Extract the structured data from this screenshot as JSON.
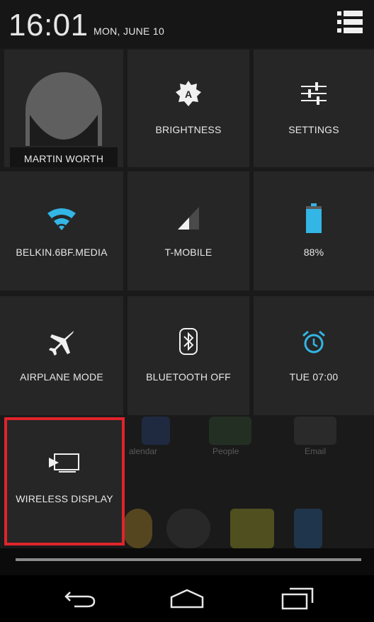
{
  "status_bar": {
    "time": "16:01",
    "date": "MON, JUNE 10"
  },
  "quick_settings": {
    "profile": {
      "name": "MARTIN WORTH"
    },
    "brightness": {
      "label": "BRIGHTNESS"
    },
    "settings": {
      "label": "SETTINGS"
    },
    "wifi": {
      "label": "BELKIN.6BF.MEDIA"
    },
    "mobile": {
      "label": "T-MOBILE"
    },
    "battery": {
      "label": "88%"
    },
    "airplane": {
      "label": "AIRPLANE MODE"
    },
    "bluetooth": {
      "label": "BLUETOOTH OFF"
    },
    "alarm": {
      "label": "TUE 07:00"
    },
    "wireless_display": {
      "label": "WIRELESS DISPLAY"
    }
  },
  "background_apps": [
    "alendar",
    "People",
    "Email"
  ],
  "accent_colors": {
    "wifi": "#33b5e5",
    "highlight": "#e0242b"
  },
  "icons": {
    "menu": "list-icon",
    "brightness": "brightness-auto-icon",
    "settings": "sliders-icon",
    "wifi": "wifi-icon",
    "signal": "signal-icon",
    "battery": "battery-icon",
    "airplane": "airplane-icon",
    "bluetooth": "bluetooth-icon",
    "alarm": "alarm-icon",
    "cast": "cast-icon",
    "back": "back-icon",
    "home": "home-icon",
    "recents": "recents-icon"
  }
}
